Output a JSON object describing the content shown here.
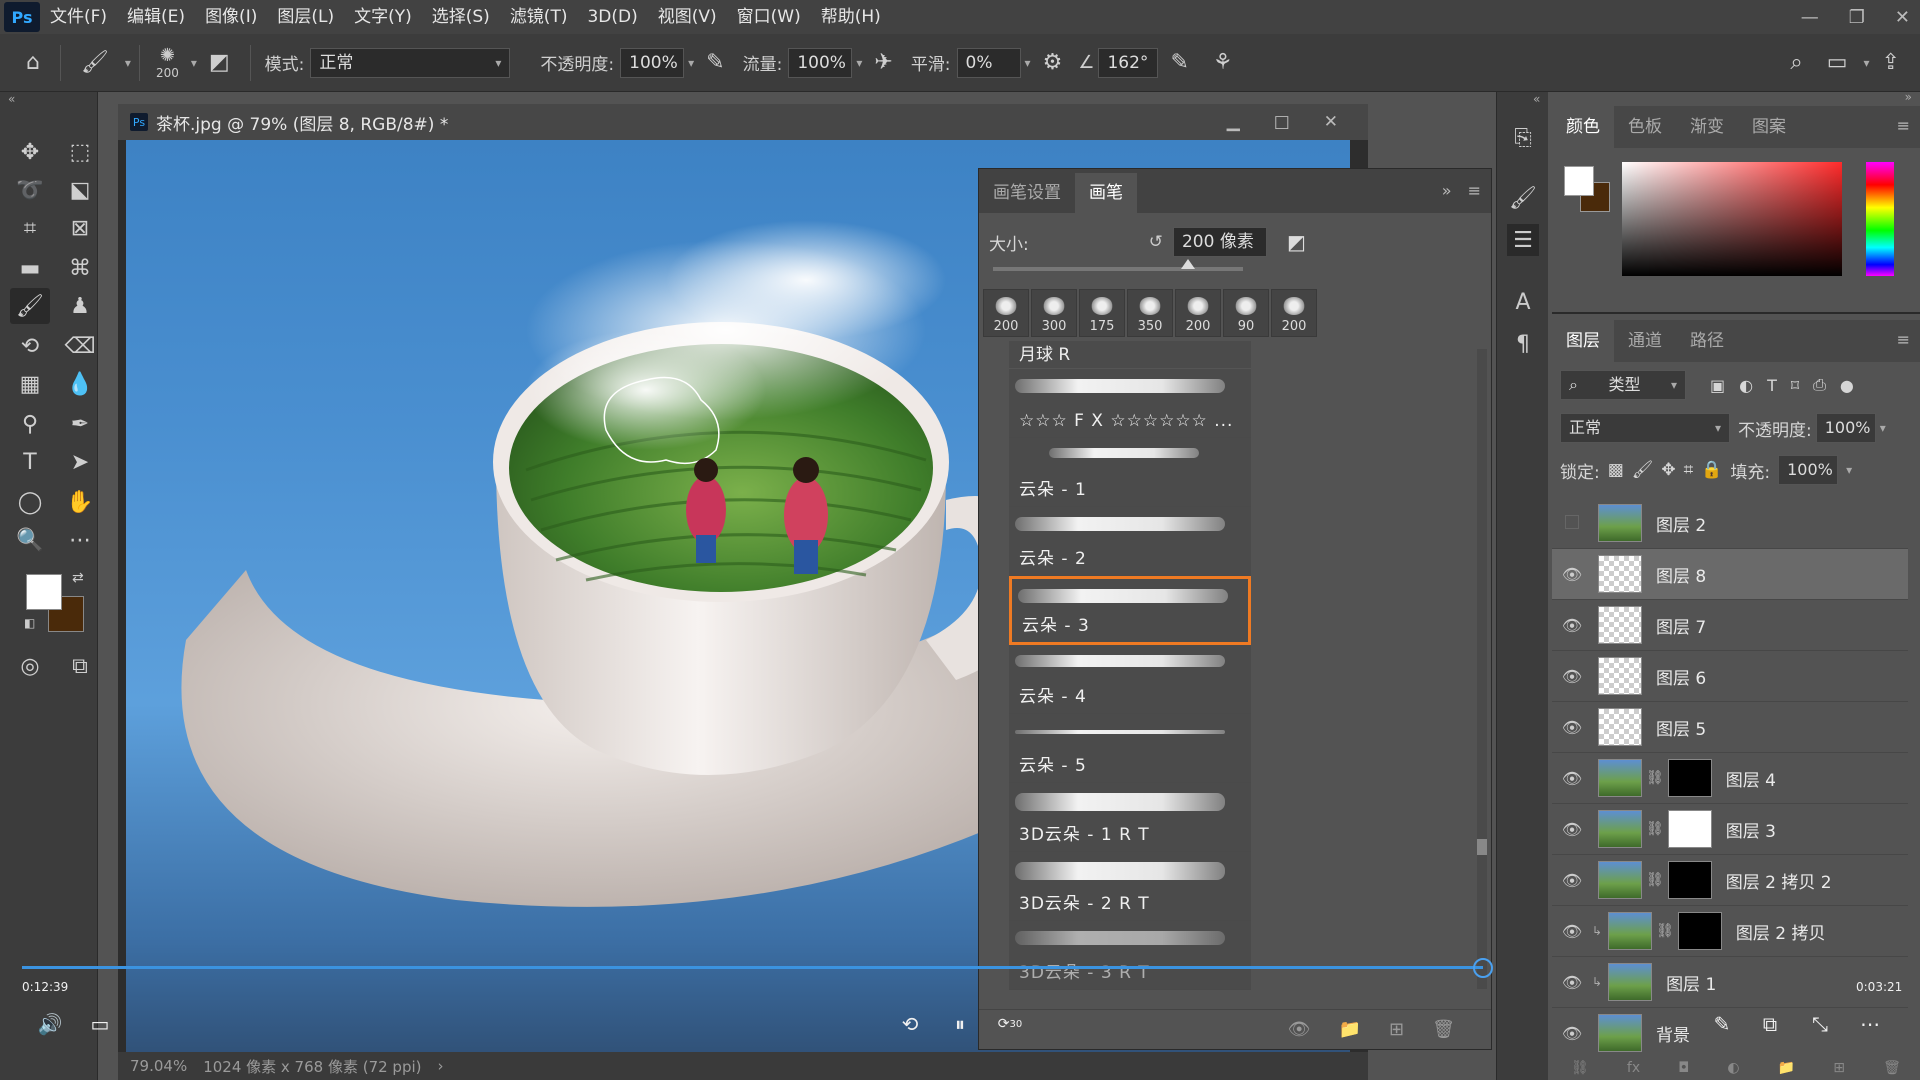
{
  "menubar": {
    "logo": "Ps",
    "items": [
      "文件(F)",
      "编辑(E)",
      "图像(I)",
      "图层(L)",
      "文字(Y)",
      "选择(S)",
      "滤镜(T)",
      "3D(D)",
      "视图(V)",
      "窗口(W)",
      "帮助(H)"
    ],
    "window_controls": [
      "—",
      "❐",
      "✕"
    ]
  },
  "options": {
    "brush_size": "200",
    "mode_label": "模式:",
    "mode_value": "正常",
    "opacity_label": "不透明度:",
    "opacity_value": "100%",
    "flow_label": "流量:",
    "flow_value": "100%",
    "smooth_label": "平滑:",
    "smooth_value": "0%",
    "angle_value": "162°"
  },
  "document": {
    "title": "茶杯.jpg @ 79% (图层 8, RGB/8#) *",
    "status_zoom": "79.04%",
    "status_info": "1024 像素 x 768 像素 (72 ppi)",
    "status_arrow": "›"
  },
  "brush_panel": {
    "tabs": [
      "画笔设置",
      "画笔"
    ],
    "active_tab": 1,
    "size_label": "大小:",
    "size_value": "200 像素",
    "size_fraction": 0.78,
    "presets": [
      "200",
      "300",
      "175",
      "350",
      "200",
      "90",
      "200"
    ],
    "list_header": "月球 R",
    "items": [
      {
        "label": "☆☆☆ F X ☆☆☆☆☆☆ ..."
      },
      {
        "label": "云朵 - 1"
      },
      {
        "label": "云朵 - 2"
      },
      {
        "label": "云朵 - 3",
        "selected": true
      },
      {
        "label": "云朵 - 4"
      },
      {
        "label": "云朵 - 5"
      },
      {
        "label": "3D云朵 - 1 R T"
      },
      {
        "label": "3D云朵 - 2 R T"
      },
      {
        "label": "3D云朵 - 3 R T"
      }
    ]
  },
  "color_panel": {
    "tabs": [
      "颜色",
      "色板",
      "渐变",
      "图案"
    ],
    "fg_color": "#ffffff",
    "bg_color": "#4a2a0a"
  },
  "layers_panel": {
    "tabs": [
      "图层",
      "通道",
      "路径"
    ],
    "filter_label": "类型",
    "blend_mode": "正常",
    "opacity_label": "不透明度:",
    "opacity_value": "100%",
    "lock_label": "锁定:",
    "fill_label": "填充:",
    "fill_value": "100%",
    "layers": [
      {
        "name": "图层 2",
        "visible": false,
        "thumb": "img"
      },
      {
        "name": "图层 8",
        "visible": true,
        "selected": true
      },
      {
        "name": "图层 7",
        "visible": true
      },
      {
        "name": "图层 6",
        "visible": true
      },
      {
        "name": "图层 5",
        "visible": true
      },
      {
        "name": "图层 4",
        "visible": true,
        "thumb": "img",
        "mask": "black"
      },
      {
        "name": "图层 3",
        "visible": true,
        "thumb": "img",
        "mask": "white"
      },
      {
        "name": "图层 2 拷贝 2",
        "visible": true,
        "thumb": "img",
        "mask": "black"
      },
      {
        "name": "图层 2 拷贝",
        "visible": true,
        "thumb": "img",
        "mask": "black"
      },
      {
        "name": "图层 1",
        "visible": true,
        "thumb": "img"
      },
      {
        "name": "背景",
        "visible": true,
        "thumb": "img"
      }
    ]
  },
  "video": {
    "current_time": "0:12:39",
    "total_time": "0:03:21",
    "progress": 0.99,
    "skip_back_label": "⟲",
    "skip_forward_label": "30"
  }
}
